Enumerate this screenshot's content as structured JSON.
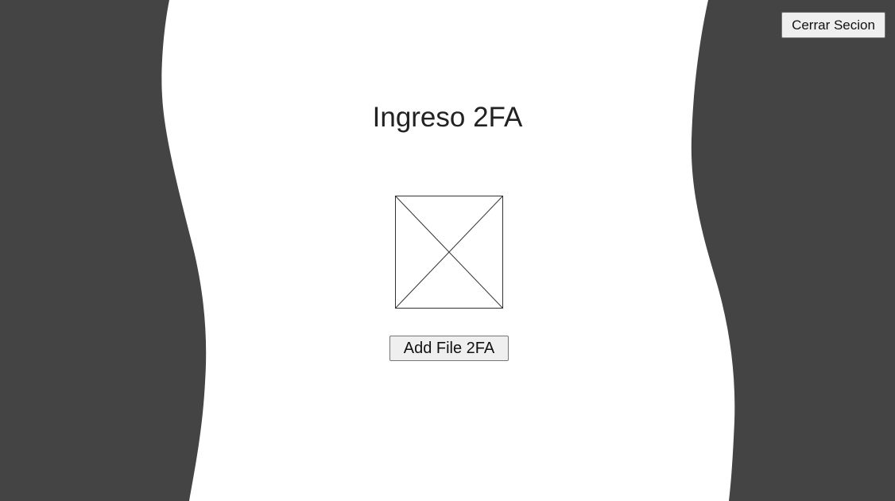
{
  "header": {
    "logout_label": "Cerrar Secion"
  },
  "main": {
    "title": "Ingreso 2FA",
    "qr_image": {
      "icon": "broken-image-placeholder-icon"
    },
    "add_file_label": "Add File 2FA"
  },
  "colors": {
    "background_side": "#444444",
    "background_center": "#ffffff",
    "text": "#222222",
    "button_bg": "#efefef",
    "button_border": "#767676"
  }
}
